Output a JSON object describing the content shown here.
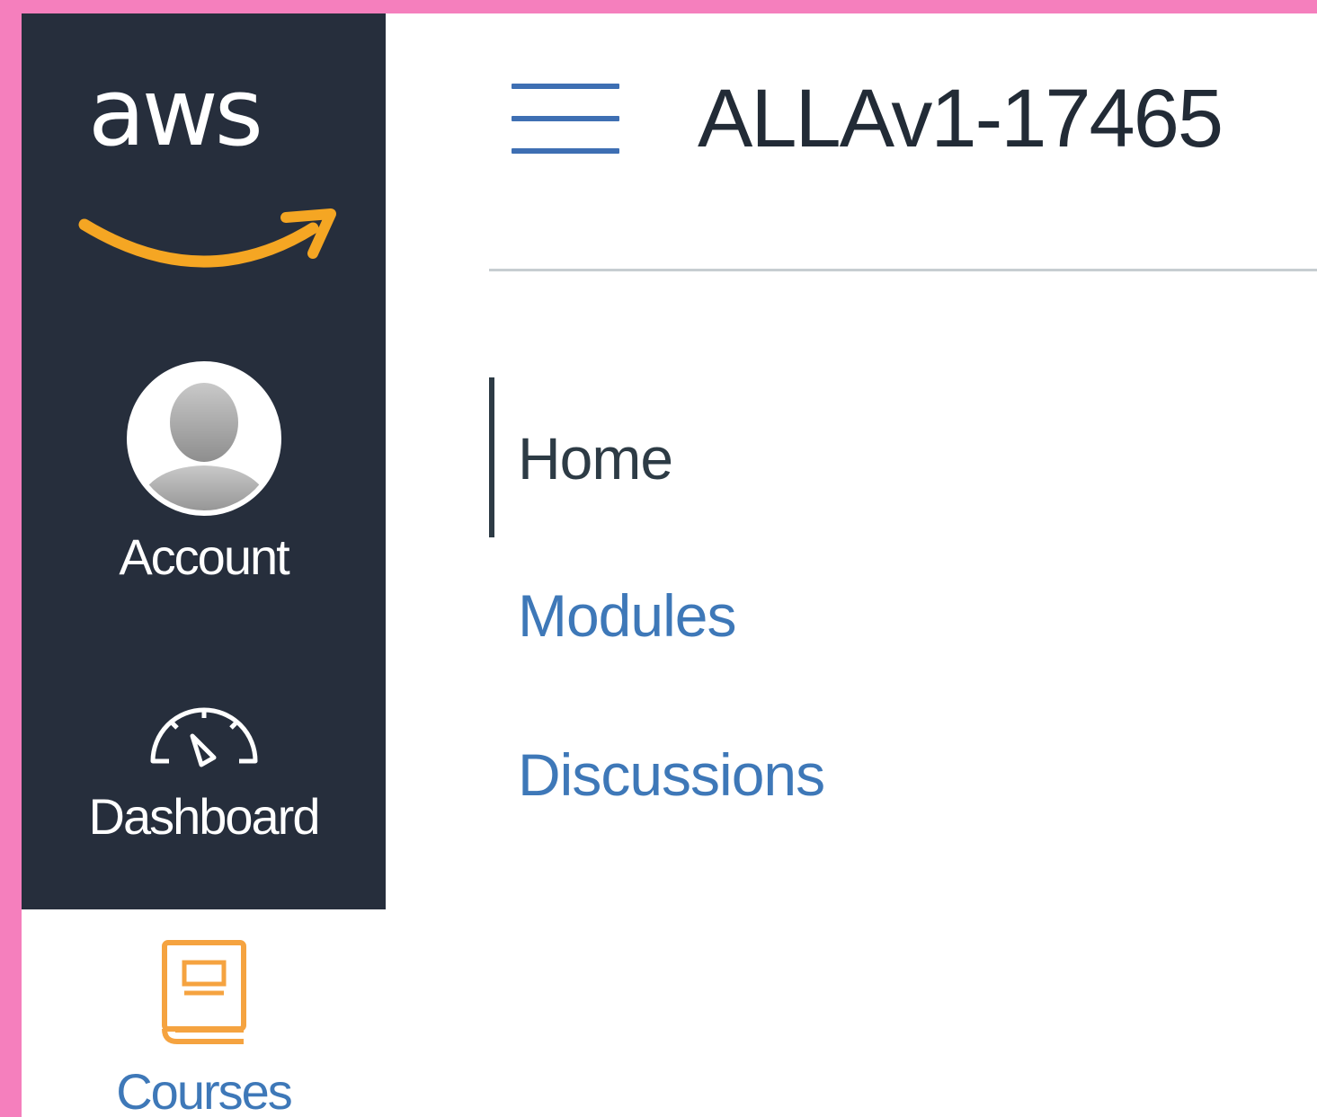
{
  "brand": {
    "logo_text": "aws",
    "colors": {
      "frame": "#f57fbd",
      "nav_background": "#262e3c",
      "smile": "#f5a623",
      "link": "#3e78b8",
      "active_text": "#2d3b45",
      "courses_icon": "#f5a340"
    }
  },
  "global_nav": {
    "items": [
      {
        "label": "Account",
        "icon": "user-avatar-icon"
      },
      {
        "label": "Dashboard",
        "icon": "dashboard-gauge-icon"
      },
      {
        "label": "Courses",
        "icon": "courses-book-icon"
      }
    ]
  },
  "header": {
    "menu_icon": "hamburger-menu-icon",
    "course_title": "ALLAv1-17465"
  },
  "course_nav": {
    "active": "Home",
    "items": [
      {
        "label": "Home"
      },
      {
        "label": "Modules"
      },
      {
        "label": "Discussions"
      }
    ]
  }
}
